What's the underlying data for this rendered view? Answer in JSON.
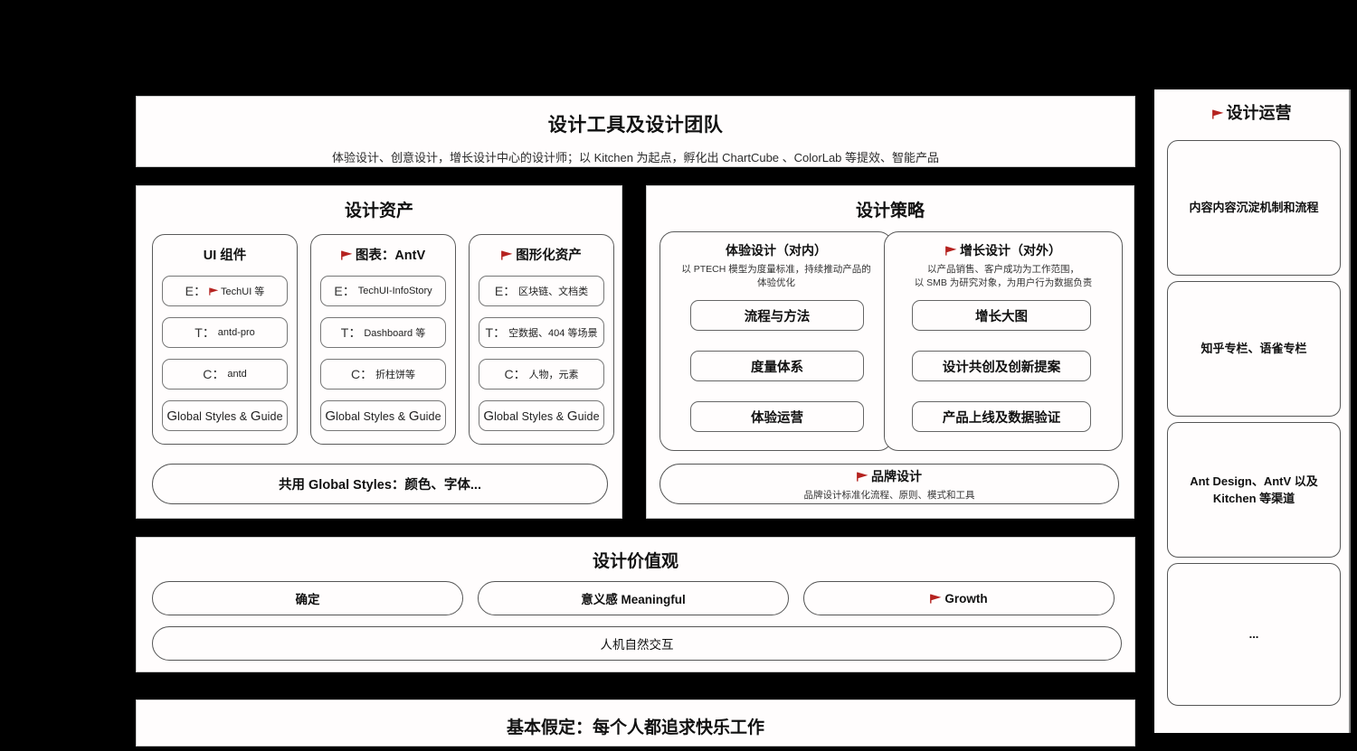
{
  "colors": {
    "flag_red": "#b5221f",
    "panel_bg": "#fffdfd",
    "page_bg": "#000000",
    "border": "#555555"
  },
  "header": {
    "title": "设计工具及设计团队",
    "subtitle": "体验设计、创意设计，增长设计中心的设计师；以 Kitchen 为起点，孵化出 ChartCube 、ColorLab 等提效、智能产品"
  },
  "assets": {
    "title": "设计资产",
    "columns": [
      {
        "title": "UI 组件",
        "flag": false,
        "items": [
          {
            "key": "E：",
            "value": "TechUI 等",
            "flag": true
          },
          {
            "key": "T：",
            "value": "antd-pro",
            "flag": false
          },
          {
            "key": "C：",
            "value": "antd",
            "flag": false
          }
        ],
        "footer": "Global Styles & Guide"
      },
      {
        "title": "图表：AntV",
        "flag": true,
        "items": [
          {
            "key": "E：",
            "value": "TechUI-InfoStory",
            "flag": false
          },
          {
            "key": "T：",
            "value": "Dashboard 等",
            "flag": false
          },
          {
            "key": "C：",
            "value": "折柱饼等",
            "flag": false
          }
        ],
        "footer": "Global Styles & Guide"
      },
      {
        "title": "图形化资产",
        "flag": true,
        "items": [
          {
            "key": "E：",
            "value": "区块链、文档类",
            "flag": false
          },
          {
            "key": "T：",
            "value": "空数据、404 等场景",
            "flag": false
          },
          {
            "key": "C：",
            "value": "人物，元素",
            "flag": false
          }
        ],
        "footer": "Global Styles & Guide"
      }
    ],
    "shared": "共用 Global Styles：颜色、字体..."
  },
  "strategy": {
    "title": "设计策略",
    "groups": [
      {
        "title": "体验设计（对内）",
        "flag": false,
        "subtitle": "以 PTECH 模型为度量标准，持续推动产品的\n体验优化",
        "items": [
          "流程与方法",
          "度量体系",
          "体验运营"
        ]
      },
      {
        "title": "增长设计（对外）",
        "flag": true,
        "subtitle": "以产品销售、客户成功为工作范围，\n以 SMB 为研究对象，为用户行为数据负责",
        "items": [
          "增长大图",
          "设计共创及创新提案",
          "产品上线及数据验证"
        ]
      }
    ],
    "brand": {
      "title": "品牌设计",
      "flag": true,
      "subtitle": "品牌设计标准化流程、原则、模式和工具"
    }
  },
  "values": {
    "title": "设计价值观",
    "pills": [
      {
        "label": "确定",
        "flag": false
      },
      {
        "label": "意义感 Meaningful",
        "flag": false
      },
      {
        "label": "Growth",
        "flag": true
      }
    ],
    "wide": "人机自然交互"
  },
  "bottom": {
    "title": "基本假定：每个人都追求快乐工作"
  },
  "sidebar": {
    "title": "设计运营",
    "flag": true,
    "cards": [
      {
        "label": "内容内容沉淀机制和流程"
      },
      {
        "label": "知乎专栏、语雀专栏"
      },
      {
        "label": "Ant Design、AntV 以及\nKitchen 等渠道"
      },
      {
        "label": "..."
      }
    ]
  }
}
